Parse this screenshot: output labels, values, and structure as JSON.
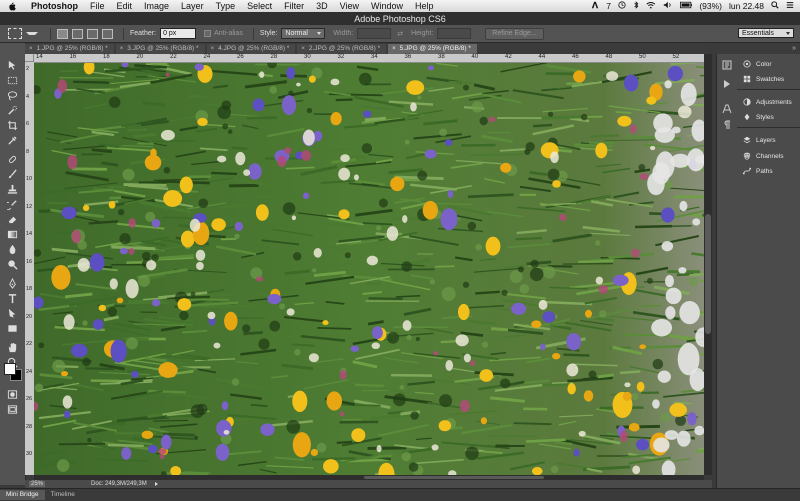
{
  "menubar": {
    "app_name": "Photoshop",
    "items": [
      "File",
      "Edit",
      "Image",
      "Layer",
      "Type",
      "Select",
      "Filter",
      "3D",
      "View",
      "Window",
      "Help"
    ],
    "status": {
      "adobe_badge": "7",
      "battery": "(93%)",
      "clock": "lun 22.48"
    }
  },
  "window": {
    "title": "Adobe Photoshop CS6"
  },
  "options_bar": {
    "feather_label": "Feather:",
    "feather_value": "0 px",
    "anti_alias_label": "Anti-alias",
    "style_label": "Style:",
    "style_value": "Normal",
    "width_label": "Width:",
    "height_label": "Height:",
    "refine_edge_label": "Refine Edge...",
    "workspace_value": "Essentials"
  },
  "tabs": [
    {
      "label": "1.JPG @ 25% (RGB/8) *",
      "active": false
    },
    {
      "label": "3.JPG @ 25% (RGB/8) *",
      "active": false
    },
    {
      "label": "4.JPG @ 25% (RGB/8) *",
      "active": false
    },
    {
      "label": "2.JPG @ 25% (RGB/8) *",
      "active": false
    },
    {
      "label": "5.JPG @ 25% (RGB/8) *",
      "active": true
    }
  ],
  "ruler": {
    "top_ticks": [
      "14",
      "16",
      "18",
      "20",
      "22",
      "24",
      "26",
      "28",
      "30",
      "32",
      "34",
      "36",
      "38",
      "40",
      "42",
      "44",
      "46",
      "48",
      "50",
      "52"
    ],
    "left_ticks": [
      "2",
      "4",
      "6",
      "8",
      "10",
      "12",
      "14",
      "16",
      "18",
      "20",
      "22",
      "24",
      "26",
      "28",
      "30"
    ]
  },
  "status_bar": {
    "zoom": "25%",
    "doc_info": "Doc: 249,3M/249,3M"
  },
  "bottom_tabs": [
    {
      "label": "Mini Bridge",
      "active": true
    },
    {
      "label": "Timeline",
      "active": false
    }
  ],
  "panels": [
    {
      "label": "Color",
      "icon": "color-wheel-icon"
    },
    {
      "label": "Swatches",
      "icon": "swatches-icon"
    },
    {
      "label": "Adjustments",
      "icon": "adjustments-icon"
    },
    {
      "label": "Styles",
      "icon": "styles-icon"
    },
    {
      "label": "Layers",
      "icon": "layers-icon"
    },
    {
      "label": "Channels",
      "icon": "channels-icon"
    },
    {
      "label": "Paths",
      "icon": "paths-icon"
    }
  ],
  "colors": {
    "ui_dark": "#3a3a3a",
    "panel": "#4b4b4b",
    "foreground_swatch": "#ffffff",
    "background_swatch": "#000000"
  }
}
